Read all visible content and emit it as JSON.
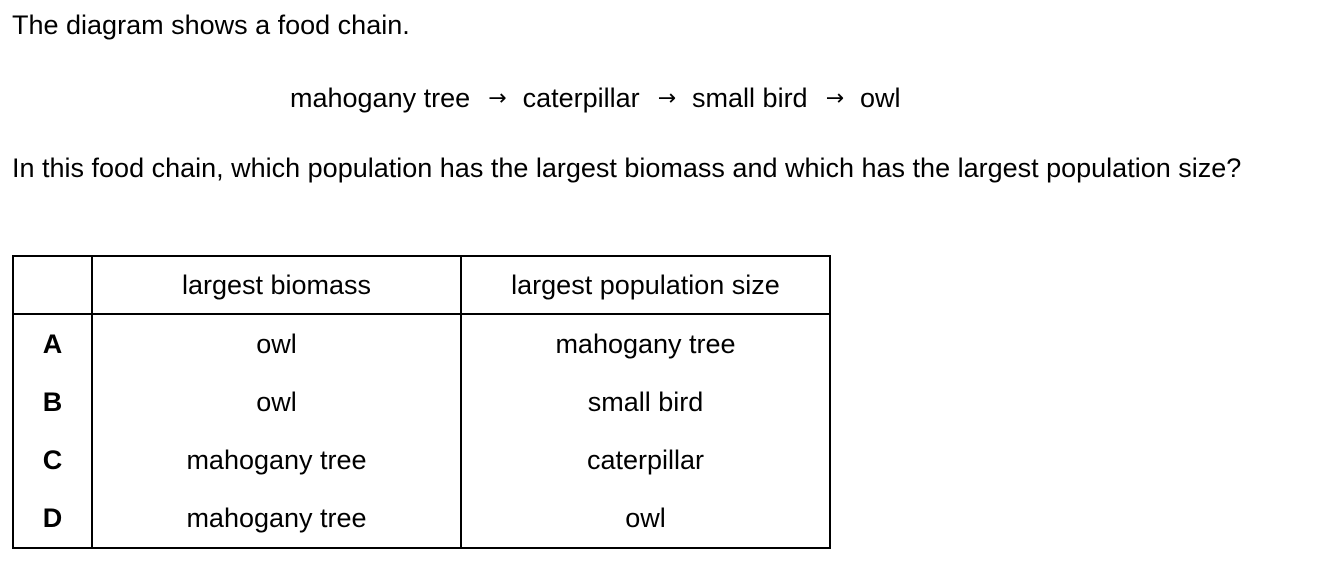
{
  "intro": "The diagram shows a food chain.",
  "food_chain": {
    "organisms": [
      "mahogany tree",
      "caterpillar",
      "small bird",
      "owl"
    ],
    "arrow": "→"
  },
  "question": "In this food chain, which population has the largest biomass and which has the largest population size?",
  "table": {
    "headers": [
      "",
      "largest biomass",
      "largest population size"
    ],
    "rows": [
      {
        "letter": "A",
        "biomass": "owl",
        "population": "mahogany tree"
      },
      {
        "letter": "B",
        "biomass": "owl",
        "population": "small bird"
      },
      {
        "letter": "C",
        "biomass": "mahogany tree",
        "population": "caterpillar"
      },
      {
        "letter": "D",
        "biomass": "mahogany tree",
        "population": "owl"
      }
    ]
  }
}
